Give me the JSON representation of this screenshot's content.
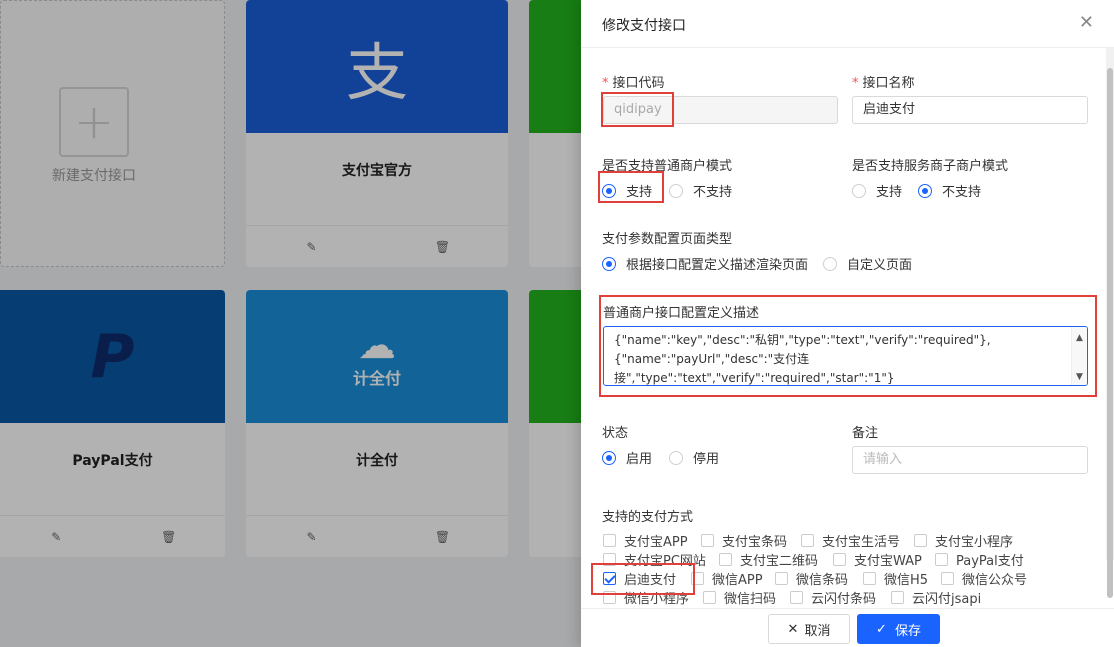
{
  "background": {
    "new_card_label": "新建支付接口",
    "cards": [
      {
        "name": "支付宝官方",
        "logo": "支",
        "color": "#1a5fd9"
      },
      {
        "name": "PayPal支付",
        "logo": "P",
        "color": "#0a5aa6"
      },
      {
        "name": "计全付",
        "logo": "计全付",
        "color": "#1a8fd9"
      }
    ]
  },
  "drawer": {
    "title": "修改支付接口",
    "close_icon": "close-icon",
    "code_label": "接口代码",
    "code_value": "qidipay",
    "name_label": "接口名称",
    "name_value": "启迪支付",
    "normal_mode_label": "是否支持普通商户模式",
    "normal_mode_options": [
      "支持",
      "不支持"
    ],
    "normal_mode_selected": "支持",
    "service_mode_label": "是否支持服务商子商户模式",
    "service_mode_options": [
      "支持",
      "不支持"
    ],
    "service_mode_selected": "不支持",
    "page_type_label": "支付参数配置页面类型",
    "page_type_options": [
      "根据接口配置定义描述渲染页面",
      "自定义页面"
    ],
    "page_type_selected": "根据接口配置定义描述渲染页面",
    "desc_label": "普通商户接口配置定义描述",
    "desc_lines": [
      "{\"name\":\"key\",\"desc\":\"私钥\",\"type\":\"text\",\"verify\":\"required\"},",
      "{\"name\":\"payUrl\",\"desc\":\"支付连接\",\"type\":\"text\",\"verify\":\"required\",\"star\":\"1\"}",
      "]"
    ],
    "status_label": "状态",
    "status_options": [
      "启用",
      "停用"
    ],
    "status_selected": "启用",
    "remark_label": "备注",
    "remark_placeholder": "请输入",
    "methods_label": "支持的支付方式",
    "methods": [
      {
        "label": "支付宝APP",
        "checked": false
      },
      {
        "label": "支付宝条码",
        "checked": false
      },
      {
        "label": "支付宝生活号",
        "checked": false
      },
      {
        "label": "支付宝小程序",
        "checked": false
      },
      {
        "label": "支付宝PC网站",
        "checked": false
      },
      {
        "label": "支付宝二维码",
        "checked": false
      },
      {
        "label": "支付宝WAP",
        "checked": false
      },
      {
        "label": "PayPal支付",
        "checked": false
      },
      {
        "label": "启迪支付",
        "checked": true
      },
      {
        "label": "微信APP",
        "checked": false
      },
      {
        "label": "微信条码",
        "checked": false
      },
      {
        "label": "微信H5",
        "checked": false
      },
      {
        "label": "微信公众号",
        "checked": false
      },
      {
        "label": "微信小程序",
        "checked": false
      },
      {
        "label": "微信扫码",
        "checked": false
      },
      {
        "label": "云闪付条码",
        "checked": false
      },
      {
        "label": "云闪付jsapi",
        "checked": false
      }
    ],
    "cancel_label": "取消",
    "save_label": "保存"
  }
}
